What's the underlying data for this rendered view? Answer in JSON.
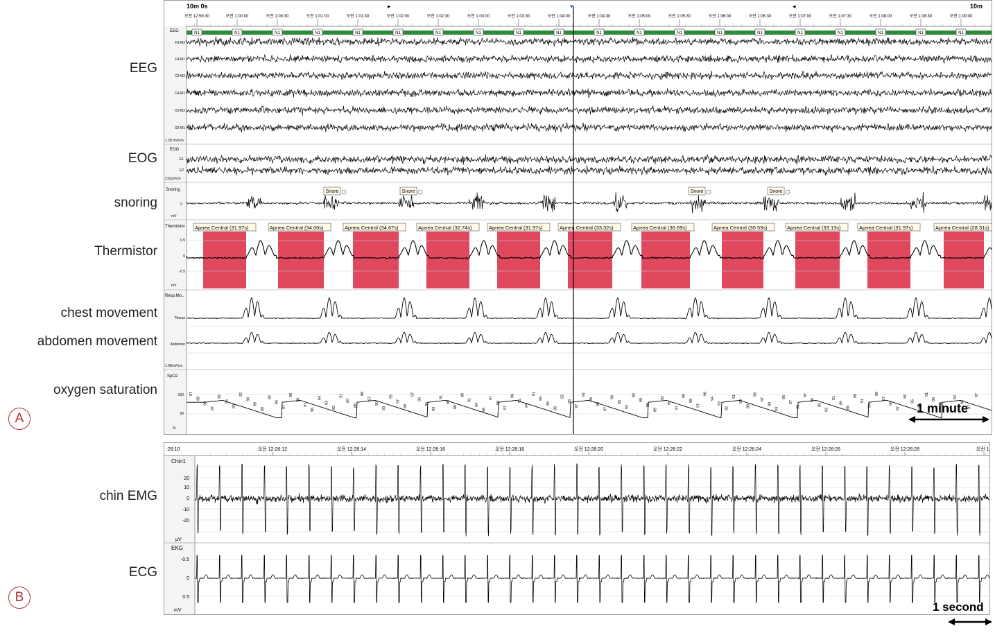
{
  "panel_a": {
    "duration": "10m 0s",
    "duration_right": "10m",
    "time_ticks": [
      "오전 12:59:30",
      "오전 1:00:00",
      "오전 1:00:30",
      "오전 1:01:00",
      "오전 1:01:30",
      "오전 1:02:00",
      "오전 1:02:30",
      "오전 1:03:00",
      "오전 1:03:30",
      "오전 1:04:00",
      "오전 1:04:30",
      "오전 1:05:00",
      "오전 1:05:30",
      "오전 1:06:00",
      "오전 1:06:30",
      "오전 1:07:00",
      "오전 1:07:30",
      "오전 1:08:00",
      "오전 1:08:30",
      "오전 1:09:00"
    ],
    "hypnogram_label": "EEG",
    "stage_label": "N1",
    "eeg_channels": [
      "F3-M2",
      "F4-M1",
      "C3-M2",
      "C4-M1",
      "O1-M2",
      "O2-M1"
    ],
    "eeg_scale": "1.28 mV/cm",
    "eog_group": "EOG",
    "eog_channels": [
      "E1",
      "E2"
    ],
    "eog_scale": "210μV/cm",
    "snoring_channel": "Snoring",
    "snoring_zero": "0",
    "snoring_unit": "mV",
    "snore_event": "Snore",
    "thermistor_channel": "Thermistor",
    "thermistor_ticks": [
      "0.5",
      "0",
      "-0.5"
    ],
    "thermistor_unit": "mV",
    "apnea_events": [
      "Apnea Central (31.97s)",
      "Apnea Central (34.00s)",
      "Apnea Central (34.67s)",
      "Apnea Central (32.74s)",
      "Apnea Central (31.97s)",
      "Apnea Central (33.32s)",
      "Apnea Central (36.69s)",
      "Apnea Central (30.53s)",
      "Apnea Central (33.13s)",
      "Apnea Central (31.97s)",
      "Apnea Central (28.31s)"
    ],
    "resp_group": "Resp.Mo..",
    "resp_channels": [
      "Thorax",
      "Abdomen"
    ],
    "resp_scale": "1.08mV/cm",
    "spo2_channel": "SpO2",
    "spo2_ticks": [
      "100",
      "90"
    ],
    "spo2_unit": "%",
    "spo2_values": [
      "97",
      "98",
      "98",
      "97",
      "96",
      "95",
      "93",
      "92",
      "90",
      "89",
      "89",
      "92",
      "95",
      "97",
      "98",
      "98",
      "97",
      "96",
      "94",
      "93",
      "92",
      "91",
      "89",
      "88",
      "88",
      "87",
      "90",
      "93",
      "95",
      "97",
      "98",
      "97",
      "96",
      "95",
      "93",
      "91",
      "89",
      "88",
      "89",
      "91",
      "94",
      "96",
      "97",
      "98",
      "97",
      "96",
      "95",
      "94",
      "91",
      "89",
      "88",
      "89",
      "92",
      "95",
      "97"
    ],
    "scale_bar": "1 minute",
    "labels": {
      "eeg": "EEG",
      "eog": "EOG",
      "snoring": "snoring",
      "thermistor": "Thermistor",
      "chest": "chest movement",
      "abdomen": "abdomen movement",
      "spo2": "oxygen saturation"
    },
    "marker": "A"
  },
  "panel_b": {
    "time_ticks": [
      ":26:10",
      "오전 12:26:12",
      "오전 12:26:14",
      "오전 12:26:16",
      "오전 12:26:18",
      "오전 12:26:20",
      "오전 12:26:22",
      "오전 12:26:24",
      "오전 12:26:26",
      "오전 12:26:28",
      "오전 12"
    ],
    "emg_channel": "Chin1",
    "emg_ticks": [
      "20",
      "10",
      "0",
      "-10",
      "-20"
    ],
    "emg_unit": "μV",
    "ekg_channel": "EKG",
    "ekg_ticks": [
      "-0.5",
      "0",
      "0.5"
    ],
    "ekg_unit": "mV",
    "scale_bar": "1 second",
    "labels": {
      "emg": "chin EMG",
      "ecg": "ECG"
    },
    "marker": "B"
  }
}
